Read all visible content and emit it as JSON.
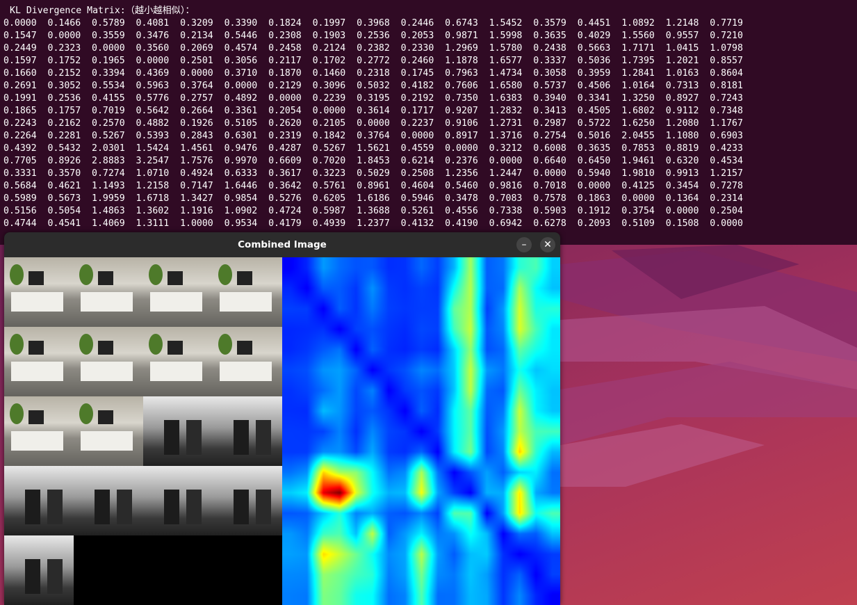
{
  "terminal": {
    "title": "KL Divergence Matrix:（越小越相似）：",
    "rows": [
      "0.0000  0.1466  0.5789  0.4081  0.3209  0.3390  0.1824  0.1997  0.3968  0.2446  0.6743  1.5452  0.3579  0.4451  1.0892  1.2148  0.7719",
      "0.1547  0.0000  0.3559  0.3476  0.2134  0.5446  0.2308  0.1903  0.2536  0.2053  0.9871  1.5998  0.3635  0.4029  1.5560  0.9557  0.7210",
      "0.2449  0.2323  0.0000  0.3560  0.2069  0.4574  0.2458  0.2124  0.2382  0.2330  1.2969  1.5780  0.2438  0.5663  1.7171  1.0415  1.0798",
      "0.1597  0.1752  0.1965  0.0000  0.2501  0.3056  0.2117  0.1702  0.2772  0.2460  1.1878  1.6577  0.3337  0.5036  1.7395  1.2021  0.8557",
      "0.1660  0.2152  0.3394  0.4369  0.0000  0.3710  0.1870  0.1460  0.2318  0.1745  0.7963  1.4734  0.3058  0.3959  1.2841  1.0163  0.8604",
      "0.2691  0.3052  0.5534  0.5963  0.3764  0.0000  0.2129  0.3096  0.5032  0.4182  0.7606  1.6580  0.5737  0.4506  1.0164  0.7313  0.8181",
      "0.1991  0.2536  0.4155  0.5776  0.2757  0.4892  0.0000  0.2239  0.3195  0.2192  0.7350  1.6383  0.3940  0.3341  1.3250  0.8927  0.7243",
      "0.1865  0.1757  0.7019  0.5642  0.2664  0.3361  0.2054  0.0000  0.3614  0.1717  0.9207  1.2832  0.3413  0.4505  1.6802  0.9112  0.7348",
      "0.2243  0.2162  0.2570  0.4882  0.1926  0.5105  0.2620  0.2105  0.0000  0.2237  0.9106  1.2731  0.2987  0.5722  1.6250  1.2080  1.1767",
      "0.2264  0.2281  0.5267  0.5393  0.2843  0.6301  0.2319  0.1842  0.3764  0.0000  0.8917  1.3716  0.2754  0.5016  2.0455  1.1080  0.6903",
      "0.4392  0.5432  2.0301  1.5424  1.4561  0.9476  0.4287  0.5267  1.5621  0.4559  0.0000  0.3212  0.6008  0.3635  0.7853  0.8819  0.4233",
      "0.7705  0.8926  2.8883  3.2547  1.7576  0.9970  0.6609  0.7020  1.8453  0.6214  0.2376  0.0000  0.6640  0.6450  1.9461  0.6320  0.4534",
      "0.3331  0.3570  0.7274  1.0710  0.4924  0.6333  0.3617  0.3223  0.5029  0.2508  1.2356  1.2447  0.0000  0.5940  1.9810  0.9913  1.2157",
      "0.5684  0.4621  1.1493  1.2158  0.7147  1.6446  0.3642  0.5761  0.8961  0.4604  0.5460  0.9816  0.7018  0.0000  0.4125  0.3454  0.7278",
      "0.5989  0.5673  1.9959  1.6718  1.3427  0.9854  0.5276  0.6205  1.6186  0.5946  0.3478  0.7083  0.7578  0.1863  0.0000  0.1364  0.2314",
      "0.5156  0.5054  1.4863  1.3602  1.1916  1.0902  0.4724  0.5987  1.3688  0.5261  0.4556  0.7338  0.5903  0.1912  0.3754  0.0000  0.2504",
      "0.4744  0.4541  1.4069  1.3111  1.0000  0.9534  0.4179  0.4939  1.2377  0.4132  0.4190  0.6942  0.6278  0.2093  0.5109  0.1508  0.0000"
    ]
  },
  "window": {
    "title": "Combined Image",
    "minimize_icon": "minimize-icon",
    "close_icon": "close-icon",
    "minimize_glyph": "–",
    "close_glyph": "✕"
  },
  "thumbnails": [
    {
      "kind": "color"
    },
    {
      "kind": "color"
    },
    {
      "kind": "color"
    },
    {
      "kind": "color"
    },
    {
      "kind": "color"
    },
    {
      "kind": "color"
    },
    {
      "kind": "color"
    },
    {
      "kind": "color"
    },
    {
      "kind": "color"
    },
    {
      "kind": "color"
    },
    {
      "kind": "gray"
    },
    {
      "kind": "gray"
    },
    {
      "kind": "gray"
    },
    {
      "kind": "gray"
    },
    {
      "kind": "gray"
    },
    {
      "kind": "gray"
    },
    {
      "kind": "gray"
    }
  ],
  "colors": {
    "terminal_bg": "#300a24",
    "titlebar_bg": "#2c2c2c"
  }
}
